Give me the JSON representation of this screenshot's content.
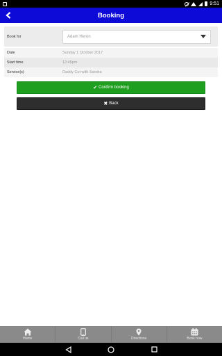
{
  "status_bar": {
    "time": "9:51"
  },
  "header": {
    "title": "Booking"
  },
  "form": {
    "book_for": {
      "label": "Book for",
      "selected": "Adam Heron"
    },
    "date": {
      "label": "Date",
      "value": "Sunday 1 October 2017"
    },
    "start_time": {
      "label": "Start time",
      "value": "12:45pm"
    },
    "services": {
      "label": "Service(s)",
      "value": "Daddy Cut with Sandra"
    }
  },
  "buttons": {
    "confirm_label": "Confirm booking",
    "back_label": "Back",
    "confirm_color": "#1f9f1f",
    "back_color": "#2e2e2e"
  },
  "bottom_nav": {
    "items": [
      {
        "label": "Home",
        "icon": "home-icon"
      },
      {
        "label": "Call us",
        "icon": "phone-icon"
      },
      {
        "label": "Directions",
        "icon": "map-pin-icon"
      },
      {
        "label": "Book now",
        "icon": "calendar-icon"
      }
    ]
  },
  "colors": {
    "header": "#0d0ad8"
  }
}
